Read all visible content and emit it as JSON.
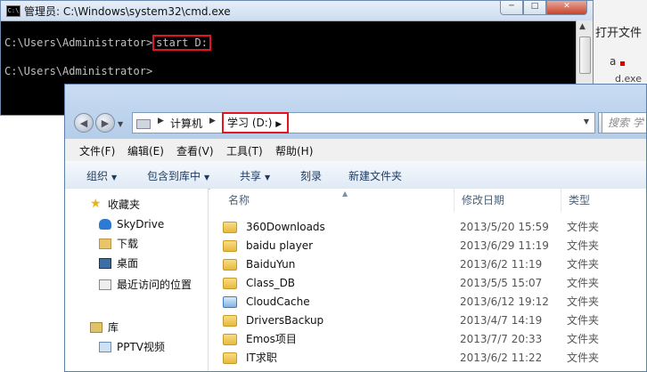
{
  "cmd": {
    "title": "管理员: C:\\Windows\\system32\\cmd.exe",
    "icon_text": "C:\\",
    "line1_prompt": "C:\\Users\\Administrator>",
    "line1_command": "start D:",
    "line2_prompt": "C:\\Users\\Administrator>",
    "buttons": {
      "minimize": "─",
      "maximize": "□",
      "close": "✕"
    }
  },
  "background_app": {
    "text1": "打开文件",
    "text2": "a",
    "text3": "d.exe"
  },
  "explorer": {
    "breadcrumb": [
      "计算机",
      "学习 (D:)"
    ],
    "search_placeholder": "搜索 学",
    "menu": [
      "文件(F)",
      "编辑(E)",
      "查看(V)",
      "工具(T)",
      "帮助(H)"
    ],
    "toolbar": [
      {
        "label": "组织",
        "dropdown": true
      },
      {
        "label": "包含到库中",
        "dropdown": true
      },
      {
        "label": "共享",
        "dropdown": true
      },
      {
        "label": "刻录",
        "dropdown": false
      },
      {
        "label": "新建文件夹",
        "dropdown": false
      }
    ],
    "nav": {
      "favorites": "收藏夹",
      "items": [
        "SkyDrive",
        "下载",
        "桌面",
        "最近访问的位置"
      ],
      "library": "库",
      "library_items": [
        "PPTV视频"
      ]
    },
    "columns": {
      "name": "名称",
      "date": "修改日期",
      "type": "类型"
    },
    "files": [
      {
        "name": "360Downloads",
        "date": "2013/5/20 15:59",
        "type": "文件夹",
        "icon": "folder-icon"
      },
      {
        "name": "baidu player",
        "date": "2013/6/29 11:19",
        "type": "文件夹",
        "icon": "folder-icon"
      },
      {
        "name": "BaiduYun",
        "date": "2013/6/2 11:19",
        "type": "文件夹",
        "icon": "folder-icon"
      },
      {
        "name": "Class_DB",
        "date": "2013/5/5 15:07",
        "type": "文件夹",
        "icon": "folder-icon"
      },
      {
        "name": "CloudCache",
        "date": "2013/6/12 19:12",
        "type": "文件夹",
        "icon": "sync-folder-icon"
      },
      {
        "name": "DriversBackup",
        "date": "2013/4/7 14:19",
        "type": "文件夹",
        "icon": "folder-icon"
      },
      {
        "name": "Emos项目",
        "date": "2013/7/7 20:33",
        "type": "文件夹",
        "icon": "folder-icon"
      },
      {
        "name": "IT求职",
        "date": "2013/6/2 11:22",
        "type": "文件夹",
        "icon": "folder-icon"
      }
    ]
  }
}
